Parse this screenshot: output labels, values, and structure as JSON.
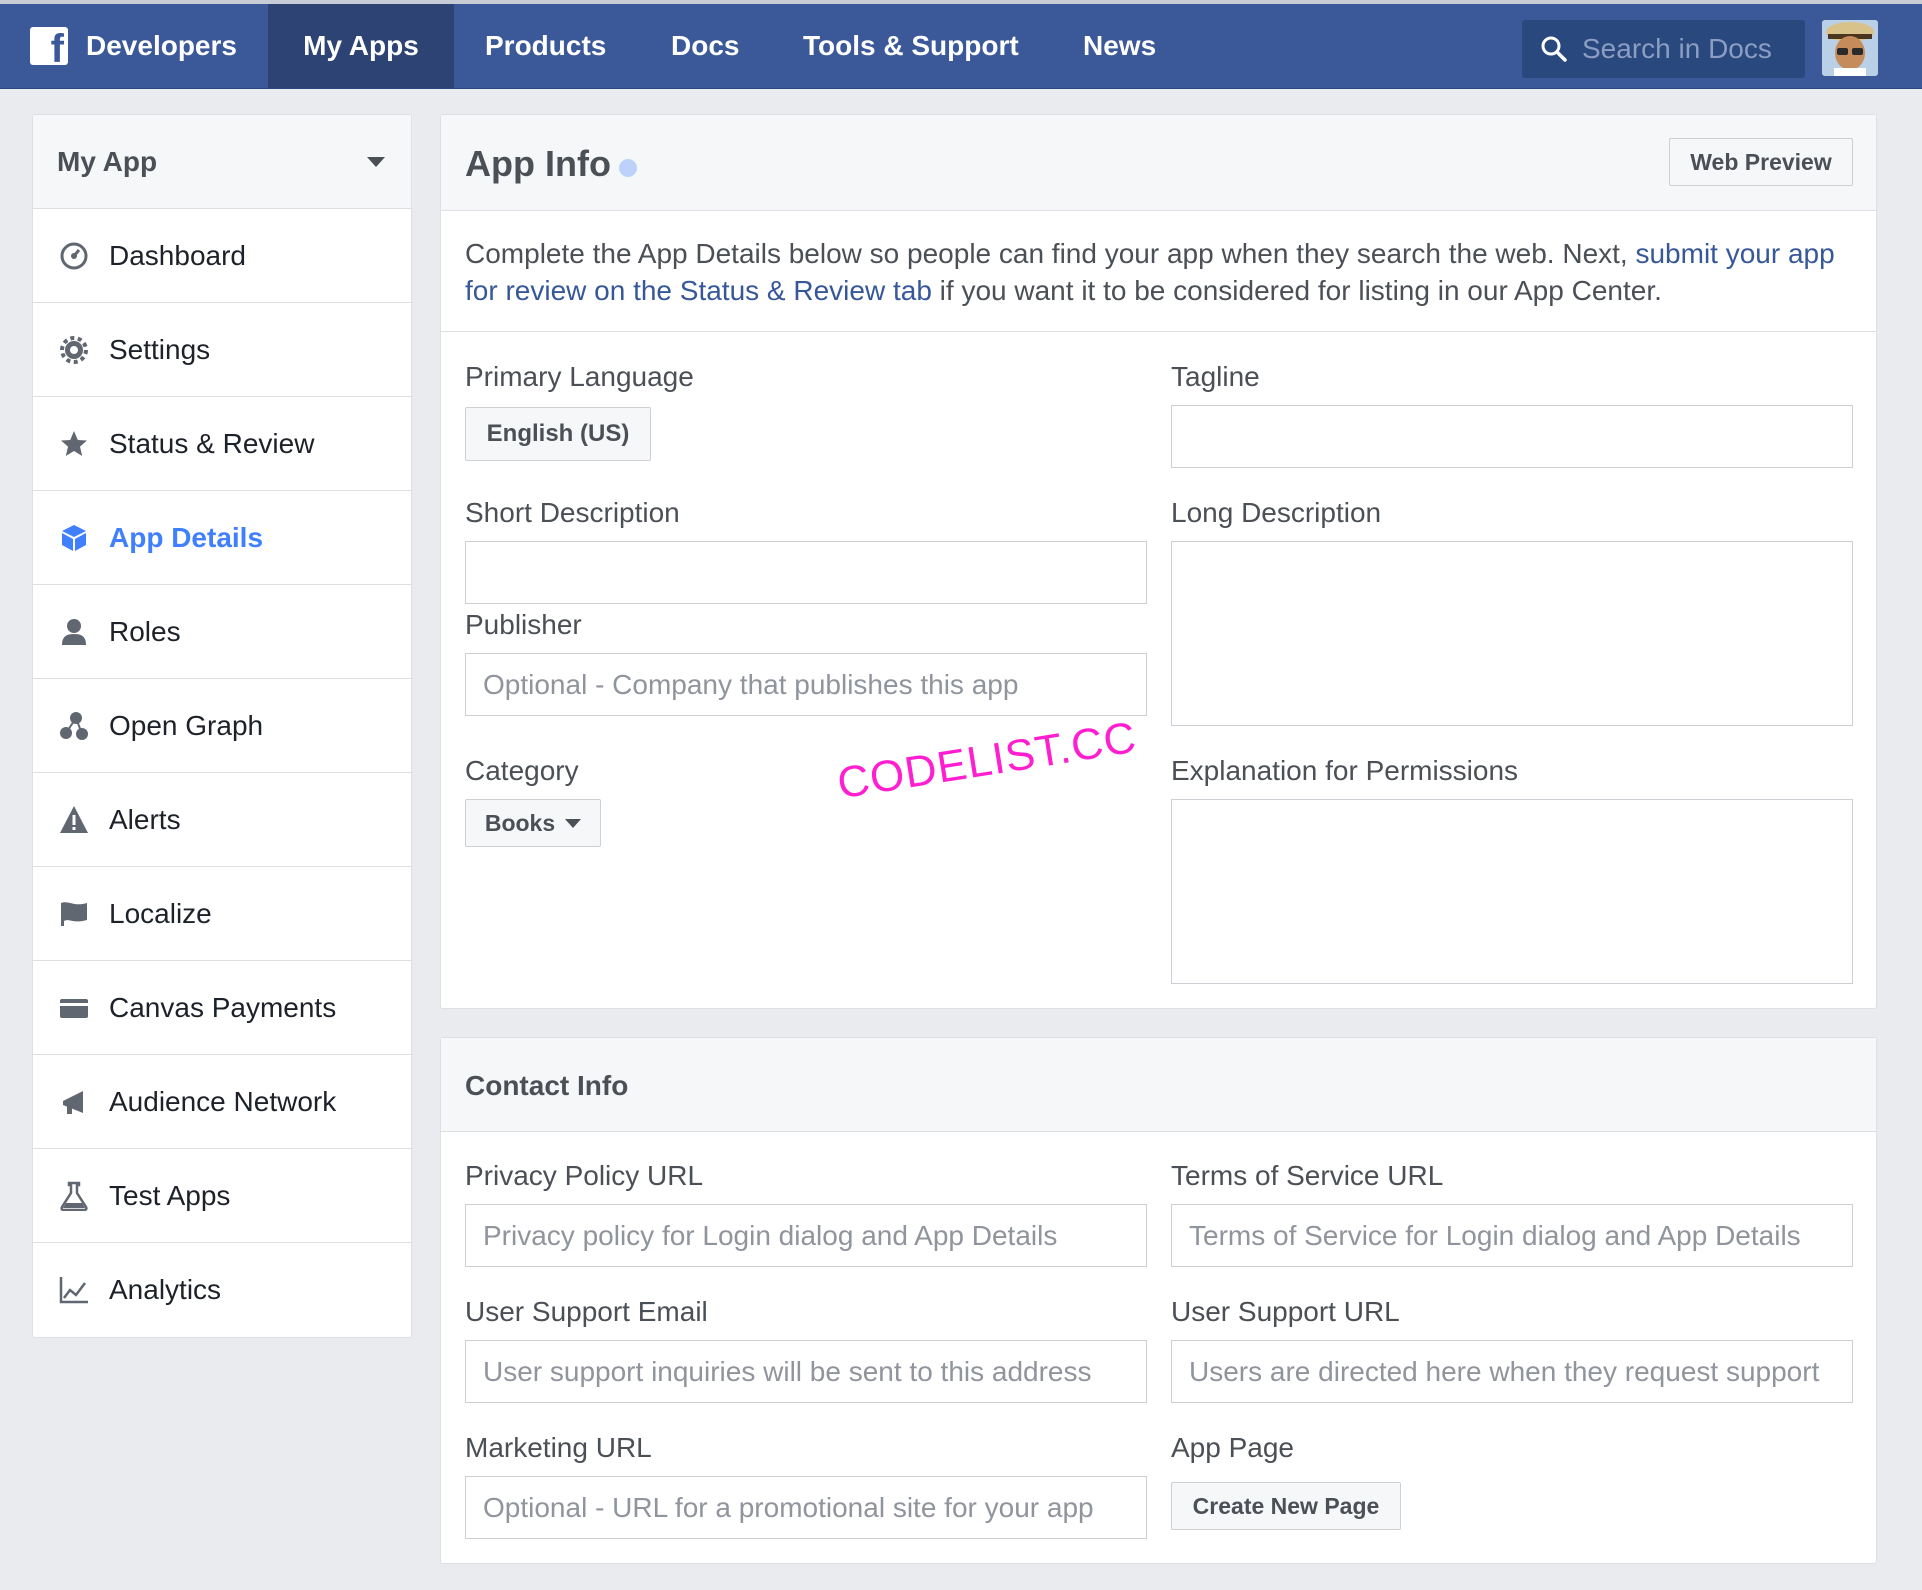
{
  "nav": {
    "brand": "Developers",
    "items": [
      "My Apps",
      "Products",
      "Docs",
      "Tools & Support",
      "News"
    ],
    "search_placeholder": "Search in Docs"
  },
  "sidebar": {
    "app_name": "My App",
    "items": [
      {
        "label": "Dashboard",
        "icon": "dashboard-icon"
      },
      {
        "label": "Settings",
        "icon": "gear-icon"
      },
      {
        "label": "Status & Review",
        "icon": "star-icon"
      },
      {
        "label": "App Details",
        "icon": "cube-icon",
        "active": true
      },
      {
        "label": "Roles",
        "icon": "person-icon"
      },
      {
        "label": "Open Graph",
        "icon": "open-graph-icon"
      },
      {
        "label": "Alerts",
        "icon": "warning-icon"
      },
      {
        "label": "Localize",
        "icon": "flag-icon"
      },
      {
        "label": "Canvas Payments",
        "icon": "credit-card-icon"
      },
      {
        "label": "Audience Network",
        "icon": "megaphone-icon"
      },
      {
        "label": "Test Apps",
        "icon": "flask-icon"
      },
      {
        "label": "Analytics",
        "icon": "chart-icon"
      }
    ]
  },
  "app_info": {
    "title": "App Info",
    "web_preview": "Web Preview",
    "intro_before": "Complete the App Details below so people can find your app when they search the web. Next, ",
    "intro_link": "submit your app for review on the Status & Review tab",
    "intro_after": " if you want it to be considered for listing in our App Center.",
    "primary_language_label": "Primary Language",
    "primary_language_value": "English (US)",
    "tagline_label": "Tagline",
    "tagline_value": "",
    "short_description_label": "Short Description",
    "short_description_value": "",
    "long_description_label": "Long Description",
    "long_description_value": "",
    "publisher_label": "Publisher",
    "publisher_placeholder": "Optional - Company that publishes this app",
    "category_label": "Category",
    "category_value": "Books",
    "permissions_label": "Explanation for Permissions",
    "permissions_value": "",
    "watermark": "CODELIST.CC"
  },
  "contact_info": {
    "title": "Contact Info",
    "privacy_label": "Privacy Policy URL",
    "privacy_placeholder": "Privacy policy for Login dialog and App Details",
    "terms_label": "Terms of Service URL",
    "terms_placeholder": "Terms of Service for Login dialog and App Details",
    "support_email_label": "User Support Email",
    "support_email_placeholder": "User support inquiries will be sent to this address",
    "support_url_label": "User Support URL",
    "support_url_placeholder": "Users are directed here when they request support",
    "marketing_label": "Marketing URL",
    "marketing_placeholder": "Optional - URL for a promotional site for your app",
    "app_page_label": "App Page",
    "create_page_button": "Create New Page"
  },
  "colors": {
    "nav_bg": "#3b5998",
    "nav_active": "#2d4373",
    "link": "#365899",
    "active_item": "#4080ff"
  }
}
